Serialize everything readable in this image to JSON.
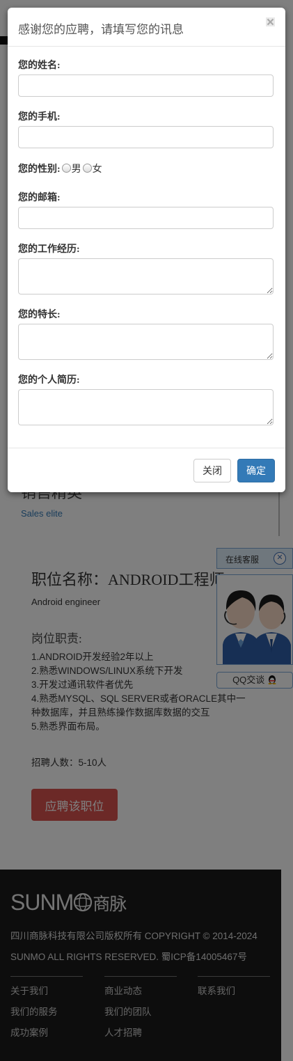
{
  "modal": {
    "title": "感谢您的应聘，请填写您的讯息",
    "close_icon": "close-icon",
    "fields": {
      "name_label": "您的姓名:",
      "phone_label": "您的手机:",
      "gender_label": "您的性别:",
      "gender_male": "男",
      "gender_female": "女",
      "email_label": "您的邮箱:",
      "experience_label": "您的工作经历:",
      "specialty_label": "您的特长:",
      "resume_label": "您的个人简历:"
    },
    "close_button": "关闭",
    "confirm_button": "确定"
  },
  "section": {
    "title": "销售精英",
    "subtitle": "Sales elite"
  },
  "job": {
    "title": "职位名称：ANDROID工程师",
    "subtitle": "Android engineer",
    "duties_heading": "岗位职责:",
    "duties": [
      "1.ANDROID开发经验2年以上",
      "2.熟悉WINDOWS/LINUX系统下开发",
      "3.开发过通讯软件者优先",
      "4.熟悉MYSQL、SQL SERVER或者ORACLE其中一种数据库，并且熟练操作数据库数据的交互",
      "5.熟悉界面布局。"
    ],
    "headcount": "招聘人数：5-10人",
    "apply_button": "应聘该职位"
  },
  "service_widget": {
    "title": "在线客服",
    "qq_label": "QQ交谈"
  },
  "footer": {
    "logo_text": "SUNM",
    "logo_cn": "商脉",
    "copyright_line1": "四川商脉科技有限公司版权所有 COPYRIGHT © 2014-2024",
    "copyright_line2": "SUNMO ALL RIGHTS RESERVED. 蜀ICP备14005467号",
    "col1": [
      "关于我们",
      "我们的服务",
      "成功案例"
    ],
    "col2": [
      "商业动态",
      "我们的团队",
      "人才招聘"
    ],
    "col3": [
      "联系我们"
    ]
  }
}
